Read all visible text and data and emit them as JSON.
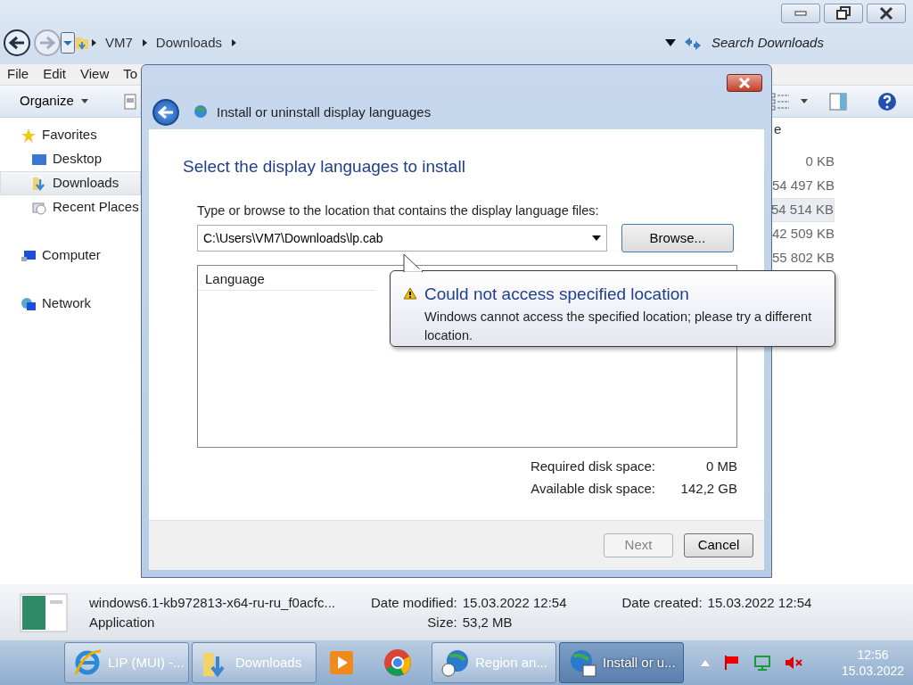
{
  "explorer": {
    "breadcrumb": [
      "VM7",
      "Downloads"
    ],
    "search": {
      "placeholder": "Search Downloads"
    },
    "menu": [
      "File",
      "Edit",
      "View",
      "To"
    ],
    "organize": "Organize",
    "nav": [
      {
        "label": "Favorites",
        "selected": false,
        "children": [
          {
            "label": "Desktop",
            "selected": false
          },
          {
            "label": "Downloads",
            "selected": true
          },
          {
            "label": "Recent Places",
            "selected": false
          }
        ]
      },
      {
        "label": "Computer",
        "selected": false
      },
      {
        "label": "Network",
        "selected": false
      }
    ],
    "size_column": {
      "header": "e",
      "rows": [
        {
          "size": "0 KB",
          "selected": false
        },
        {
          "size": "54 497 KB",
          "selected": false
        },
        {
          "size": "54 514 KB",
          "selected": true
        },
        {
          "size": "42 509 KB",
          "selected": false
        },
        {
          "size": "55 802 KB",
          "selected": false
        }
      ]
    }
  },
  "dialog": {
    "title": "Install or uninstall display languages",
    "heading": "Select the display languages to install",
    "prompt": "Type or browse to the location that contains the display language files:",
    "path": "C:\\Users\\VM7\\Downloads\\lp.cab",
    "browse": "Browse...",
    "list_column": "Language",
    "disk": [
      {
        "label": "Required disk space:",
        "value": "0 MB"
      },
      {
        "label": "Available disk space:",
        "value": "142,2 GB"
      }
    ],
    "buttons": [
      {
        "label": "Next",
        "disabled": true
      },
      {
        "label": "Cancel",
        "disabled": false
      }
    ],
    "balloon": {
      "title": "Could not access specified location",
      "text": "Windows cannot access the specified location; please try a different location."
    }
  },
  "details": {
    "name": "windows6.1-kb972813-x64-ru-ru_f0acfc...",
    "type": "Application",
    "fields": [
      {
        "label": "Date modified:",
        "value": "15.03.2022 12:54"
      },
      {
        "label": "Size:",
        "value": "53,2 MB"
      },
      {
        "label": "Date created:",
        "value": "15.03.2022 12:54"
      }
    ]
  },
  "taskbar": {
    "items": [
      {
        "label": "LIP (MUI) -...",
        "selected": false
      },
      {
        "label": "Downloads",
        "selected": false
      },
      {
        "selected": false
      },
      {
        "selected": false
      },
      {
        "label": "Region an...",
        "selected": false
      },
      {
        "label": "Install or u...",
        "selected": true
      }
    ],
    "time": "12:56",
    "date": "15.03.2022"
  }
}
